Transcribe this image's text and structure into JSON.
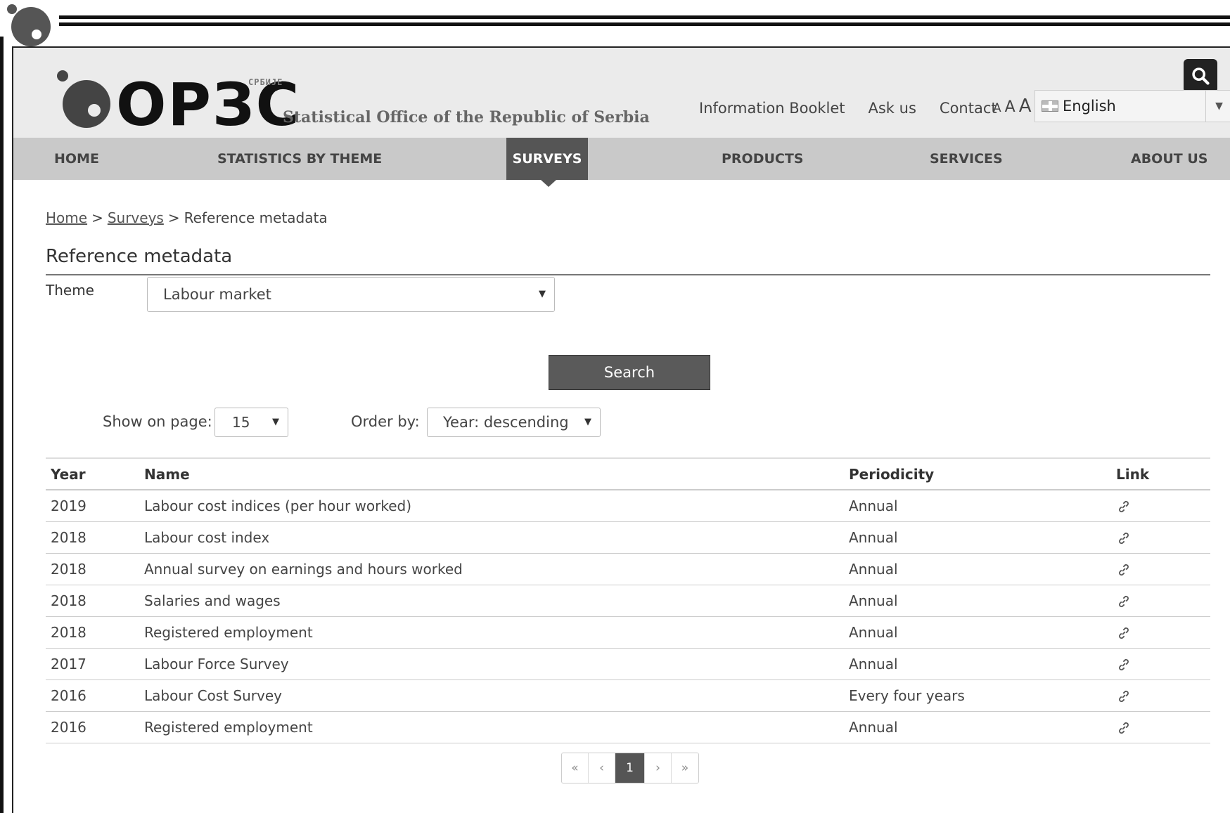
{
  "header": {
    "logo_letters": "ОРЗС",
    "logo_sup": "СРБИЈЕ",
    "org_name": "Statistical Office of the Republic of Serbia",
    "top_links": [
      "Information Booklet",
      "Ask us",
      "Contact"
    ],
    "font_sizes": [
      "A",
      "A",
      "A"
    ],
    "language": "English"
  },
  "nav": {
    "items": [
      {
        "label": "HOME"
      },
      {
        "label": "STATISTICS BY THEME"
      },
      {
        "label": "SURVEYS"
      },
      {
        "label": "PRODUCTS"
      },
      {
        "label": "SERVICES"
      },
      {
        "label": "ABOUT US"
      }
    ],
    "active": "SURVEYS"
  },
  "breadcrumb": {
    "home": "Home",
    "surveys": "Surveys",
    "current": "Reference metadata",
    "sep": ">"
  },
  "page_title": "Reference metadata",
  "filters": {
    "theme_label": "Theme",
    "theme_value": "Labour market",
    "search_label": "Search",
    "show_label": "Show on page:",
    "show_value": "15",
    "order_label": "Order by:",
    "order_value": "Year: descending"
  },
  "table": {
    "headers": {
      "year": "Year",
      "name": "Name",
      "periodicity": "Periodicity",
      "link": "Link"
    },
    "rows": [
      {
        "year": "2019",
        "name": "Labour cost indices (per hour worked)",
        "periodicity": "Annual"
      },
      {
        "year": "2018",
        "name": "Labour cost index",
        "periodicity": "Annual"
      },
      {
        "year": "2018",
        "name": "Annual survey on earnings and hours worked",
        "periodicity": "Annual"
      },
      {
        "year": "2018",
        "name": "Salaries and wages",
        "periodicity": "Annual"
      },
      {
        "year": "2018",
        "name": "Registered employment",
        "periodicity": "Annual"
      },
      {
        "year": "2017",
        "name": "Labour Force Survey",
        "periodicity": "Annual"
      },
      {
        "year": "2016",
        "name": "Labour Cost Survey",
        "periodicity": "Every four years"
      },
      {
        "year": "2016",
        "name": "Registered employment",
        "periodicity": "Annual"
      }
    ]
  },
  "pagination": {
    "first": "«",
    "prev": "‹",
    "current": "1",
    "next": "›",
    "last": "»"
  },
  "icons": {
    "search": "search-icon",
    "link": "link-icon",
    "flag": "uk-flag-icon",
    "caret": "chevron-down-icon"
  },
  "colors": {
    "header_bg": "#ebebeb",
    "nav_bg": "#c9c9c9",
    "nav_active": "#555555",
    "button": "#5a5a5a"
  }
}
